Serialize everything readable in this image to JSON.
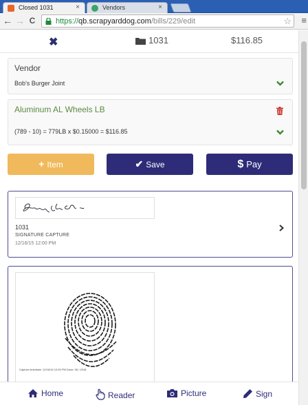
{
  "browser": {
    "tabs": [
      {
        "title": "Closed 1031",
        "active": true
      },
      {
        "title": "Vendors",
        "active": false
      }
    ],
    "url": {
      "scheme": "https://",
      "host": "qb.scrapyarddog.com",
      "path": "/bills/229/edit"
    },
    "nav": {
      "back": "←",
      "forward": "→",
      "reload": "C",
      "star": "☆",
      "menu": "≡"
    },
    "tab_close": "×"
  },
  "summary": {
    "close_glyph": "✖",
    "bill_number": "1031",
    "total": "$116.85"
  },
  "vendor": {
    "label": "Vendor",
    "name": "Bob's Burger Joint"
  },
  "line_item": {
    "material": "Aluminum AL Wheels LB",
    "formula": "(789 - 10) = 779LB x $0.15000 = $116.85"
  },
  "actions": {
    "add_item": "Item",
    "add_item_glyph": "+",
    "save": "Save",
    "save_glyph": "✔",
    "pay": "Pay",
    "pay_glyph": "$"
  },
  "attachments": [
    {
      "number": "1031",
      "type": "SIGNATURE CAPTURE",
      "date": "12/16/15 12:00 PM"
    },
    {
      "caption": "Capture time/date: 12/16/15 12:00 PM  Done: 06 / 2018"
    }
  ],
  "footer": {
    "home": "Home",
    "reader": "Reader",
    "picture": "Picture",
    "sign": "Sign"
  },
  "colors": {
    "primary": "#2e2c78",
    "accent": "#f0b95b",
    "success": "#5c8a43",
    "danger": "#c9302c"
  }
}
